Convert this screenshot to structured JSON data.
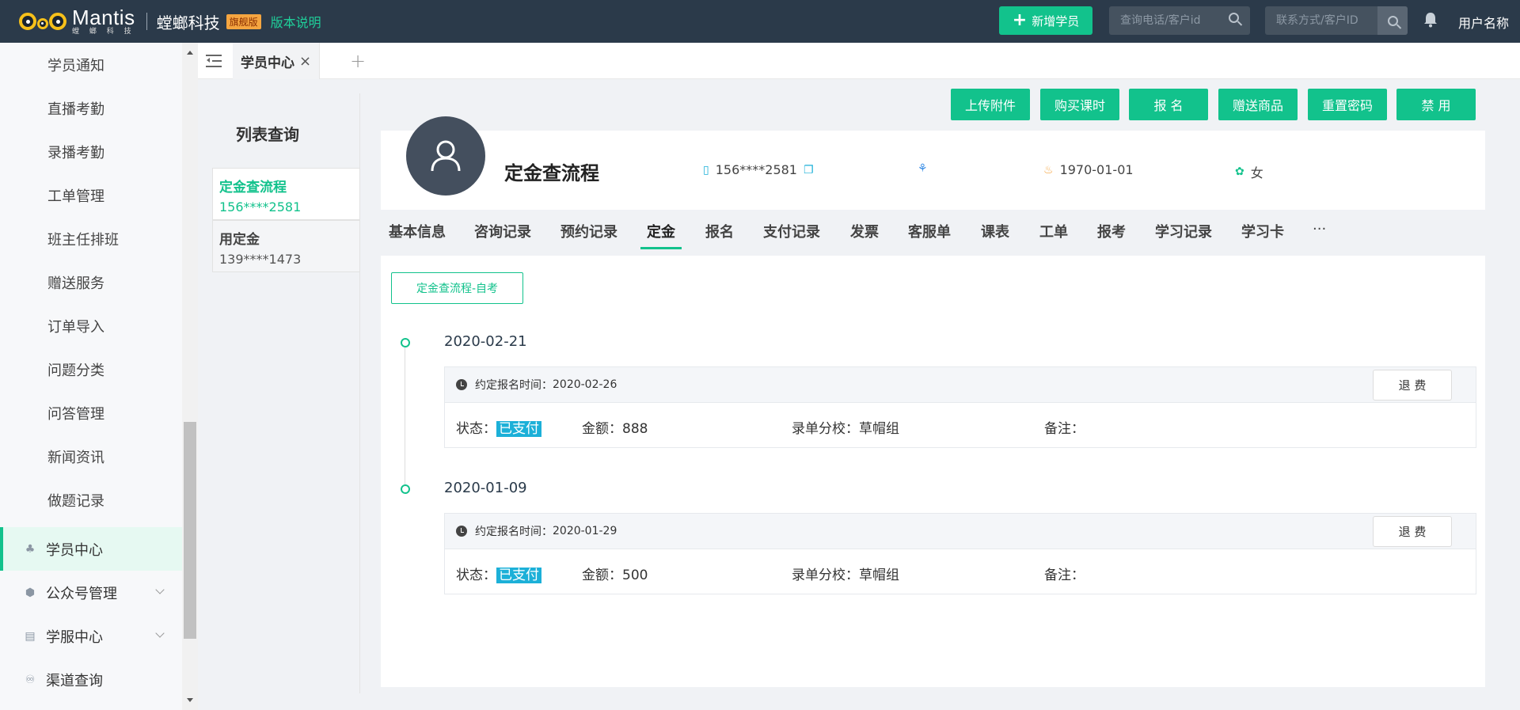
{
  "topbar": {
    "logo_text": "Mantis",
    "logo_sub": "螳 螂 科 技",
    "brand": "螳螂科技",
    "badge": "旗舰版",
    "version_link": "版本说明",
    "add_student": "新增学员",
    "search_phone_placeholder": "查询电话/客户id",
    "search_contact_placeholder": "联系方式/客户ID",
    "user_name": "用户名称"
  },
  "sidebar": {
    "sub_items": [
      "学员通知",
      "直播考勤",
      "录播考勤",
      "工单管理",
      "班主任排班",
      "赠送服务",
      "订单导入",
      "问题分类",
      "问答管理",
      "新闻资讯",
      "做题记录"
    ],
    "top_items": [
      {
        "label": "学员中心",
        "icon": "student-icon",
        "active": true
      },
      {
        "label": "公众号管理",
        "icon": "shield-icon",
        "expandable": true
      },
      {
        "label": "学服中心",
        "icon": "document-icon",
        "expandable": true
      },
      {
        "label": "渠道查询",
        "icon": "channel-icon"
      }
    ]
  },
  "tabbar": {
    "tab_label": "学员中心",
    "close": "×",
    "add": "+"
  },
  "list": {
    "title": "列表查询",
    "cards": [
      {
        "name": "定金查流程",
        "phone": "156****2581"
      },
      {
        "name": "用定金",
        "phone": "139****1473"
      }
    ]
  },
  "actions": [
    "上传附件",
    "购买课时",
    "报 名",
    "赠送商品",
    "重置密码",
    "禁 用"
  ],
  "profile": {
    "name": "定金查流程",
    "phone": "156****2581",
    "birthday": "1970-01-01",
    "gender": "女"
  },
  "detail_tabs": [
    "基本信息",
    "咨询记录",
    "预约记录",
    "定金",
    "报名",
    "支付记录",
    "发票",
    "客服单",
    "课表",
    "工单",
    "报考",
    "学习记录",
    "学习卡",
    "···"
  ],
  "content": {
    "filter_tag": "定金查流程-自考",
    "records": [
      {
        "date": "2020-02-21",
        "appoint_label": "约定报名时间：",
        "appoint_time": "2020-02-26",
        "refund": "退 费",
        "status_label": "状态：",
        "status": "已支付",
        "amount_label": "金额：",
        "amount": "888",
        "branch_label": "录单分校：",
        "branch": "草帽组",
        "remark_label": "备注："
      },
      {
        "date": "2020-01-09",
        "appoint_label": "约定报名时间：",
        "appoint_time": "2020-01-29",
        "refund": "退 费",
        "status_label": "状态：",
        "status": "已支付",
        "amount_label": "金额：",
        "amount": "500",
        "branch_label": "录单分校：",
        "branch": "草帽组",
        "remark_label": "备注："
      }
    ]
  },
  "colors": {
    "primary": "#12c28c",
    "topbar": "#2b3a4a",
    "paid": "#1cb0d8"
  }
}
